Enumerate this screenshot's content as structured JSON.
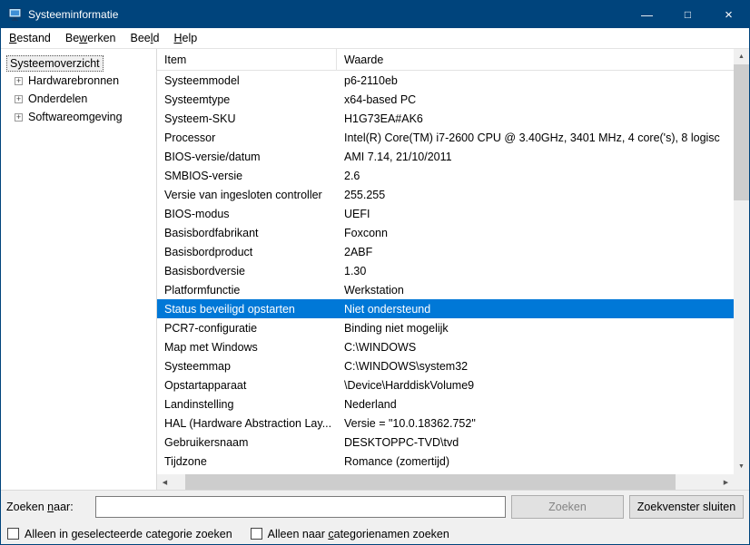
{
  "colors": {
    "titlebar": "#00447c",
    "selection": "#0078d7"
  },
  "window": {
    "title": "Systeeminformatie",
    "controls": {
      "minimize": "—",
      "maximize": "□",
      "close": "×"
    }
  },
  "menu": {
    "items": [
      {
        "label": "Bestand",
        "u": 0
      },
      {
        "label": "Bewerken",
        "u": 2
      },
      {
        "label": "Beeld",
        "u": 3
      },
      {
        "label": "Help",
        "u": 0
      }
    ]
  },
  "tree": {
    "root": "Systeemoverzicht",
    "expand_glyph": "+",
    "items": [
      "Hardwarebronnen",
      "Onderdelen",
      "Softwareomgeving"
    ]
  },
  "table": {
    "columns": [
      "Item",
      "Waarde"
    ],
    "selected_index": 12,
    "rows": [
      {
        "item": "Systeemmodel",
        "value": "p6-2110eb"
      },
      {
        "item": "Systeemtype",
        "value": "x64-based PC"
      },
      {
        "item": "Systeem-SKU",
        "value": "H1G73EA#AK6"
      },
      {
        "item": "Processor",
        "value": "Intel(R) Core(TM) i7-2600 CPU @ 3.40GHz, 3401 MHz, 4 core('s), 8 logisc"
      },
      {
        "item": "BIOS-versie/datum",
        "value": "AMI 7.14, 21/10/2011"
      },
      {
        "item": "SMBIOS-versie",
        "value": "2.6"
      },
      {
        "item": "Versie van ingesloten controller",
        "value": "255.255"
      },
      {
        "item": "BIOS-modus",
        "value": "UEFI"
      },
      {
        "item": "Basisbordfabrikant",
        "value": "Foxconn"
      },
      {
        "item": "Basisbordproduct",
        "value": "2ABF"
      },
      {
        "item": "Basisbordversie",
        "value": "1.30"
      },
      {
        "item": "Platformfunctie",
        "value": "Werkstation"
      },
      {
        "item": "Status beveiligd opstarten",
        "value": "Niet ondersteund"
      },
      {
        "item": "PCR7-configuratie",
        "value": "Binding niet mogelijk"
      },
      {
        "item": "Map met Windows",
        "value": "C:\\WINDOWS"
      },
      {
        "item": "Systeemmap",
        "value": "C:\\WINDOWS\\system32"
      },
      {
        "item": "Opstartapparaat",
        "value": "\\Device\\HarddiskVolume9"
      },
      {
        "item": "Landinstelling",
        "value": "Nederland"
      },
      {
        "item": "HAL (Hardware Abstraction Lay...",
        "value": "Versie = \"10.0.18362.752\""
      },
      {
        "item": "Gebruikersnaam",
        "value": "DESKTOPPC-TVD\\tvd"
      },
      {
        "item": "Tijdzone",
        "value": "Romance (zomertijd)"
      }
    ]
  },
  "scrollbar": {
    "up": "▲",
    "down": "▼",
    "left": "◀",
    "right": "▶"
  },
  "search": {
    "label": {
      "label": "Zoeken naar:",
      "u": 7
    },
    "input_value": "",
    "search_button": "Zoeken",
    "close_button": "Zoekvenster sluiten",
    "checkboxes": [
      {
        "label": "Alleen in geselecteerde categorie zoeken",
        "u": 10
      },
      {
        "label": "Alleen naar categorienamen zoeken",
        "u": 12
      }
    ]
  }
}
